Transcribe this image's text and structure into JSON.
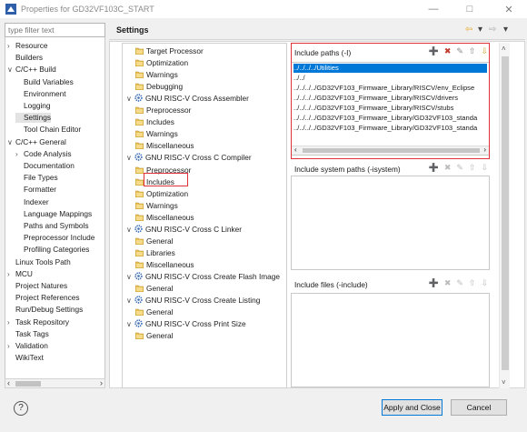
{
  "window": {
    "title": "Properties for GD32VF103C_START",
    "minimize": "—",
    "maximize": "□",
    "close": "✕"
  },
  "filter": {
    "placeholder": "type filter text"
  },
  "nav": {
    "items": [
      {
        "label": "Resource",
        "indent": 0,
        "toggle": "›"
      },
      {
        "label": "Builders",
        "indent": 0,
        "toggle": ""
      },
      {
        "label": "C/C++ Build",
        "indent": 0,
        "toggle": "∨"
      },
      {
        "label": "Build Variables",
        "indent": 1,
        "toggle": ""
      },
      {
        "label": "Environment",
        "indent": 1,
        "toggle": ""
      },
      {
        "label": "Logging",
        "indent": 1,
        "toggle": ""
      },
      {
        "label": "Settings",
        "indent": 1,
        "toggle": "",
        "selected": true
      },
      {
        "label": "Tool Chain Editor",
        "indent": 1,
        "toggle": ""
      },
      {
        "label": "C/C++ General",
        "indent": 0,
        "toggle": "∨"
      },
      {
        "label": "Code Analysis",
        "indent": 1,
        "toggle": "›"
      },
      {
        "label": "Documentation",
        "indent": 1,
        "toggle": ""
      },
      {
        "label": "File Types",
        "indent": 1,
        "toggle": ""
      },
      {
        "label": "Formatter",
        "indent": 1,
        "toggle": ""
      },
      {
        "label": "Indexer",
        "indent": 1,
        "toggle": ""
      },
      {
        "label": "Language Mappings",
        "indent": 1,
        "toggle": ""
      },
      {
        "label": "Paths and Symbols",
        "indent": 1,
        "toggle": ""
      },
      {
        "label": "Preprocessor Include",
        "indent": 1,
        "toggle": ""
      },
      {
        "label": "Profiling Categories",
        "indent": 1,
        "toggle": ""
      },
      {
        "label": "Linux Tools Path",
        "indent": 0,
        "toggle": ""
      },
      {
        "label": "MCU",
        "indent": 0,
        "toggle": "›"
      },
      {
        "label": "Project Natures",
        "indent": 0,
        "toggle": ""
      },
      {
        "label": "Project References",
        "indent": 0,
        "toggle": ""
      },
      {
        "label": "Run/Debug Settings",
        "indent": 0,
        "toggle": ""
      },
      {
        "label": "Task Repository",
        "indent": 0,
        "toggle": "›"
      },
      {
        "label": "Task Tags",
        "indent": 0,
        "toggle": ""
      },
      {
        "label": "Validation",
        "indent": 0,
        "toggle": "›"
      },
      {
        "label": "WikiText",
        "indent": 0,
        "toggle": ""
      }
    ],
    "scroll_left": "‹",
    "scroll_right": "›"
  },
  "header": {
    "title": "Settings",
    "back_arrow": "⇦",
    "dropdown": "▾",
    "forward_arrow": "⇨",
    "menu": "▾"
  },
  "tools": {
    "items": [
      {
        "label": "Target Processor",
        "indent": 1,
        "icon": "folder",
        "toggle": ""
      },
      {
        "label": "Optimization",
        "indent": 1,
        "icon": "folder",
        "toggle": ""
      },
      {
        "label": "Warnings",
        "indent": 1,
        "icon": "folder",
        "toggle": ""
      },
      {
        "label": "Debugging",
        "indent": 1,
        "icon": "folder",
        "toggle": ""
      },
      {
        "label": "GNU RISC-V Cross Assembler",
        "indent": 0,
        "icon": "gear",
        "toggle": "∨"
      },
      {
        "label": "Preprocessor",
        "indent": 1,
        "icon": "folder",
        "toggle": ""
      },
      {
        "label": "Includes",
        "indent": 1,
        "icon": "folder",
        "toggle": ""
      },
      {
        "label": "Warnings",
        "indent": 1,
        "icon": "folder",
        "toggle": ""
      },
      {
        "label": "Miscellaneous",
        "indent": 1,
        "icon": "folder",
        "toggle": ""
      },
      {
        "label": "GNU RISC-V Cross C Compiler",
        "indent": 0,
        "icon": "gear",
        "toggle": "∨"
      },
      {
        "label": "Preprocessor",
        "indent": 1,
        "icon": "folder",
        "toggle": ""
      },
      {
        "label": "Includes",
        "indent": 1,
        "icon": "folder",
        "toggle": "",
        "highlighted": true
      },
      {
        "label": "Optimization",
        "indent": 1,
        "icon": "folder",
        "toggle": ""
      },
      {
        "label": "Warnings",
        "indent": 1,
        "icon": "folder",
        "toggle": ""
      },
      {
        "label": "Miscellaneous",
        "indent": 1,
        "icon": "folder",
        "toggle": ""
      },
      {
        "label": "GNU RISC-V Cross C Linker",
        "indent": 0,
        "icon": "gear",
        "toggle": "∨"
      },
      {
        "label": "General",
        "indent": 1,
        "icon": "folder",
        "toggle": ""
      },
      {
        "label": "Libraries",
        "indent": 1,
        "icon": "folder",
        "toggle": ""
      },
      {
        "label": "Miscellaneous",
        "indent": 1,
        "icon": "folder",
        "toggle": ""
      },
      {
        "label": "GNU RISC-V Cross Create Flash Image",
        "indent": 0,
        "icon": "gear",
        "toggle": "∨"
      },
      {
        "label": "General",
        "indent": 1,
        "icon": "folder",
        "toggle": ""
      },
      {
        "label": "GNU RISC-V Cross Create Listing",
        "indent": 0,
        "icon": "gear",
        "toggle": "∨"
      },
      {
        "label": "General",
        "indent": 1,
        "icon": "folder",
        "toggle": ""
      },
      {
        "label": "GNU RISC-V Cross Print Size",
        "indent": 0,
        "icon": "gear",
        "toggle": "∨"
      },
      {
        "label": "General",
        "indent": 1,
        "icon": "folder",
        "toggle": ""
      }
    ]
  },
  "include_paths": {
    "label": "Include paths (-I)",
    "rows": [
      "../../../../Utilities",
      "../../",
      "../../../../GD32VF103_Firmware_Library/RISCV/env_Eclipse",
      "../../../../GD32VF103_Firmware_Library/RISCV/drivers",
      "../../../../GD32VF103_Firmware_Library/RISCV/stubs",
      "../../../../GD32VF103_Firmware_Library/GD32VF103_standa",
      "../../../../GD32VF103_Firmware_Library/GD32VF103_standa"
    ],
    "selected_index": 0
  },
  "include_system": {
    "label": "Include system paths (-isystem)"
  },
  "include_files": {
    "label": "Include files (-include)"
  },
  "buttons": {
    "apply_close": "Apply and Close",
    "cancel": "Cancel",
    "help": "?"
  },
  "colors": {
    "accent": "#0078d7",
    "highlight_frame": "#e0303a"
  }
}
